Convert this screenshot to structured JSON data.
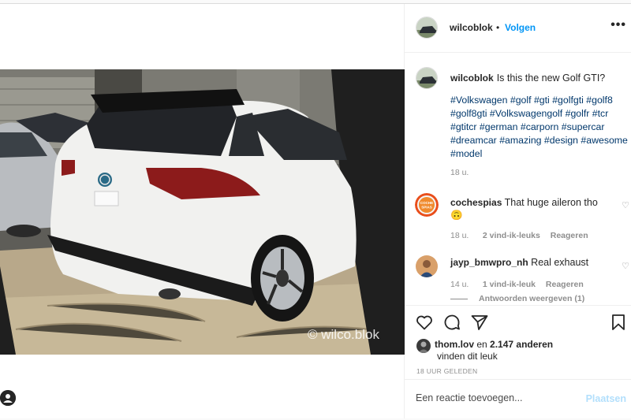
{
  "post": {
    "author": "wilcoblok",
    "separator": "•",
    "follow_label": "Volgen",
    "more_label": "•••",
    "caption_text": "Is this the new Golf GTI?",
    "hashtags": "#Volkswagen #golf #gti #golfgti #golf8 #golf8gti #Volkswagengolf #golfr #tcr #gtitcr #german #carporn #supercar #dreamcar #amazing #design #awesome #model",
    "caption_time": "18 u.",
    "watermark": "© wilco.blok"
  },
  "comments": [
    {
      "username": "cochespias",
      "text": "That huge aileron tho 🙃",
      "time": "18 u.",
      "likes": "2 vind-ik-leuks",
      "reply": "Reageren",
      "avatar_text": "COCHE SPIAS"
    },
    {
      "username": "jayp_bmwpro_nh",
      "text": "Real exhaust",
      "time": "14 u.",
      "likes": "1 vind-ik-leuk",
      "reply": "Reageren",
      "view_replies": "Antwoorden weergeven (1)"
    }
  ],
  "likes": {
    "liker": "thom.lov",
    "connector": "en",
    "others": "2.147 anderen",
    "suffix": "vinden dit leuk"
  },
  "posted_ago": "18 UUR GELEDEN",
  "comment_box": {
    "placeholder": "Een reactie toevoegen...",
    "post_label": "Plaatsen"
  },
  "icons": [
    "heart-icon",
    "comment-icon",
    "share-icon",
    "bookmark-icon",
    "more-icon",
    "user-icon"
  ],
  "colors": {
    "link": "#0095f6",
    "hashtag": "#00376b",
    "muted": "#8e8e8e",
    "post_disabled": "#b2dffc"
  }
}
